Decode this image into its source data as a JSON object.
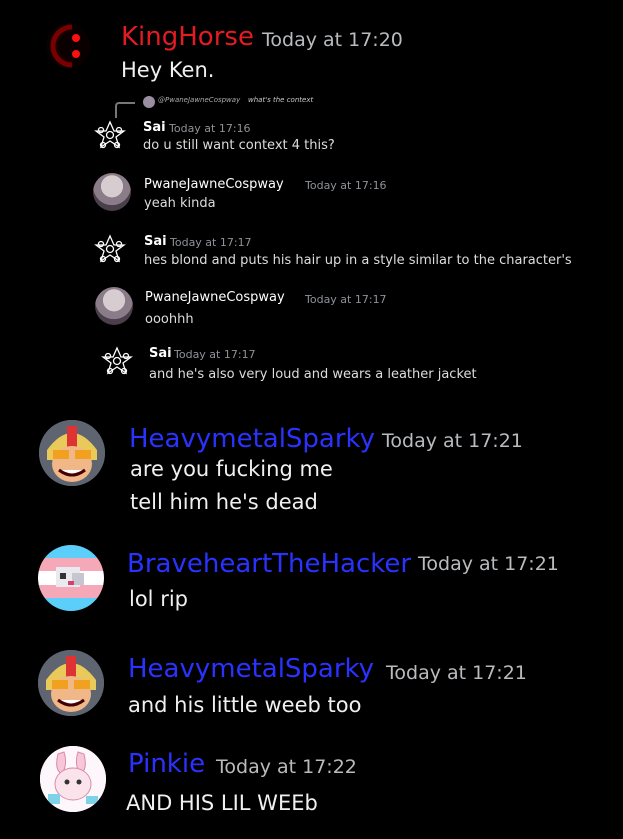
{
  "colors": {
    "background": "#000000",
    "kinghorse": "#e31b23",
    "member_blue": "#2a32ff"
  },
  "messages": [
    {
      "author": "KingHorse",
      "time": "Today at 17:20",
      "lines": [
        "Hey Ken."
      ]
    },
    {
      "author": "HeavymetalSparky",
      "time": "Today at 17:21",
      "lines": [
        "are you fucking me",
        "tell him he's dead"
      ]
    },
    {
      "author": "BraveheartTheHacker",
      "time": "Today at 17:21",
      "lines": [
        "lol rip"
      ]
    },
    {
      "author": "HeavymetalSparky",
      "time": "Today at 17:21",
      "lines": [
        "and his little weeb too"
      ]
    },
    {
      "author": "Pinkie",
      "time": "Today at 17:22",
      "lines": [
        "AND HIS LIL WEEb"
      ]
    }
  ],
  "embed": {
    "reply_preview": {
      "author": "@PwaneJawneCospway",
      "text": "what's the context"
    },
    "messages": [
      {
        "author": "Sai",
        "time": "Today at 17:16",
        "text": "do u still want context 4 this?"
      },
      {
        "author": "PwaneJawneCospway",
        "time": "Today at 17:16",
        "text": "yeah kinda"
      },
      {
        "author": "Sai",
        "time": "Today at 17:17",
        "text": "hes blond and puts his hair up in a style similar to the character's"
      },
      {
        "author": "PwaneJawneCospway",
        "time": "Today at 17:17",
        "text": "ooohhh"
      },
      {
        "author": "Sai",
        "time": "Today at 17:17",
        "text": "and he's also very loud and wears a leather jacket"
      }
    ]
  }
}
